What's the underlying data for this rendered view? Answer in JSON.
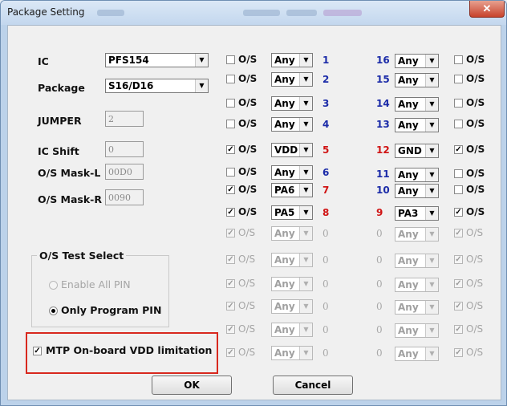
{
  "window": {
    "title": "Package Setting",
    "close_glyph": "✕"
  },
  "fields": {
    "ic_label": "IC",
    "ic_value": "PFS154",
    "package_label": "Package",
    "package_value": "S16/D16",
    "jumper_label": "JUMPER",
    "jumper_value": "2",
    "ic_shift_label": "IC Shift",
    "ic_shift_value": "0",
    "mask_l_label": "O/S Mask-L",
    "mask_l_value": "00D0",
    "mask_r_label": "O/S Mask-R",
    "mask_r_value": "0090"
  },
  "test_select": {
    "title": "O/S Test Select",
    "enable_all_label": "Enable All PIN",
    "enable_all_selected": false,
    "only_program_label": "Only Program PIN",
    "only_program_selected": true
  },
  "mtp": {
    "label": "MTP On-board VDD limitation",
    "checked": true
  },
  "os_label": "O/S",
  "left_pins": [
    {
      "os_checked": false,
      "value": "Any",
      "pin": "1",
      "pin_color": "blue",
      "enabled": true
    },
    {
      "os_checked": false,
      "value": "Any",
      "pin": "2",
      "pin_color": "blue",
      "enabled": true
    },
    {
      "os_checked": false,
      "value": "Any",
      "pin": "3",
      "pin_color": "blue",
      "enabled": true
    },
    {
      "os_checked": false,
      "value": "Any",
      "pin": "4",
      "pin_color": "blue",
      "enabled": true
    },
    {
      "os_checked": true,
      "value": "VDD",
      "pin": "5",
      "pin_color": "red",
      "enabled": true
    },
    {
      "os_checked": false,
      "value": "Any",
      "pin": "6",
      "pin_color": "blue",
      "enabled": true
    },
    {
      "os_checked": true,
      "value": "PA6",
      "pin": "7",
      "pin_color": "red",
      "enabled": true
    },
    {
      "os_checked": true,
      "value": "PA5",
      "pin": "8",
      "pin_color": "red",
      "enabled": true
    },
    {
      "os_checked": true,
      "value": "Any",
      "pin": "0",
      "pin_color": "gray",
      "enabled": false
    },
    {
      "os_checked": true,
      "value": "Any",
      "pin": "0",
      "pin_color": "gray",
      "enabled": false
    },
    {
      "os_checked": true,
      "value": "Any",
      "pin": "0",
      "pin_color": "gray",
      "enabled": false
    },
    {
      "os_checked": true,
      "value": "Any",
      "pin": "0",
      "pin_color": "gray",
      "enabled": false
    },
    {
      "os_checked": true,
      "value": "Any",
      "pin": "0",
      "pin_color": "gray",
      "enabled": false
    },
    {
      "os_checked": true,
      "value": "Any",
      "pin": "0",
      "pin_color": "gray",
      "enabled": false
    }
  ],
  "right_pins": [
    {
      "pin": "16",
      "pin_color": "blue",
      "value": "Any",
      "os_checked": false,
      "enabled": true
    },
    {
      "pin": "15",
      "pin_color": "blue",
      "value": "Any",
      "os_checked": false,
      "enabled": true
    },
    {
      "pin": "14",
      "pin_color": "blue",
      "value": "Any",
      "os_checked": false,
      "enabled": true
    },
    {
      "pin": "13",
      "pin_color": "blue",
      "value": "Any",
      "os_checked": false,
      "enabled": true
    },
    {
      "pin": "12",
      "pin_color": "red",
      "value": "GND",
      "os_checked": true,
      "enabled": true
    },
    {
      "pin": "11",
      "pin_color": "blue",
      "value": "Any",
      "os_checked": false,
      "enabled": true
    },
    {
      "pin": "10",
      "pin_color": "blue",
      "value": "Any",
      "os_checked": false,
      "enabled": true
    },
    {
      "pin": "9",
      "pin_color": "red",
      "value": "PA3",
      "os_checked": true,
      "enabled": true
    },
    {
      "pin": "0",
      "pin_color": "gray",
      "value": "Any",
      "os_checked": true,
      "enabled": false
    },
    {
      "pin": "0",
      "pin_color": "gray",
      "value": "Any",
      "os_checked": true,
      "enabled": false
    },
    {
      "pin": "0",
      "pin_color": "gray",
      "value": "Any",
      "os_checked": true,
      "enabled": false
    },
    {
      "pin": "0",
      "pin_color": "gray",
      "value": "Any",
      "os_checked": true,
      "enabled": false
    },
    {
      "pin": "0",
      "pin_color": "gray",
      "value": "Any",
      "os_checked": true,
      "enabled": false
    },
    {
      "pin": "0",
      "pin_color": "gray",
      "value": "Any",
      "os_checked": true,
      "enabled": false
    }
  ],
  "buttons": {
    "ok": "OK",
    "cancel": "Cancel"
  },
  "icons": {
    "checkbox_mark": "✓",
    "dropdown_arrow": "▼"
  }
}
